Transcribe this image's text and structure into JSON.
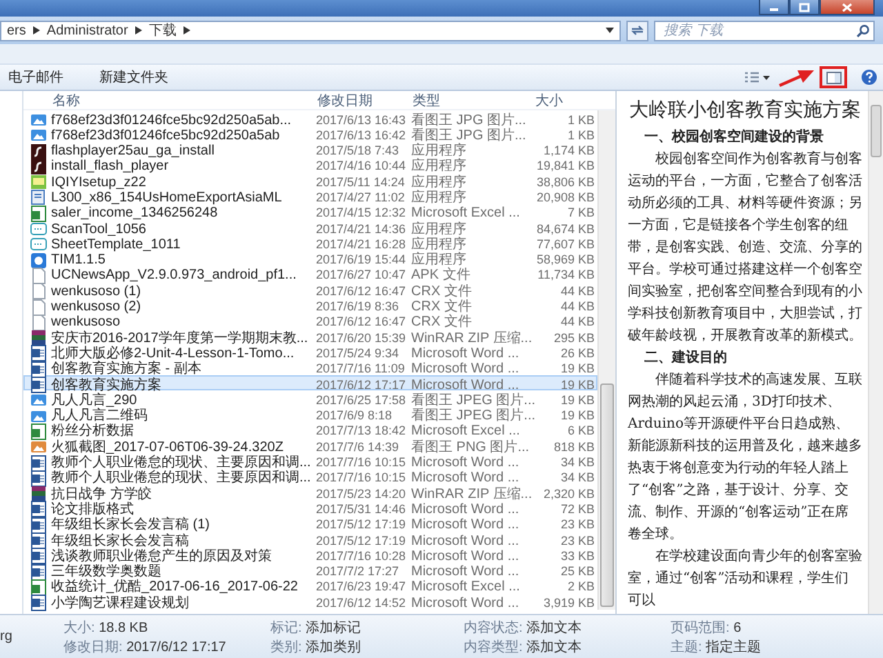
{
  "address_bar": {
    "path": [
      "ers",
      "Administrator",
      "下载"
    ],
    "search": {
      "placeholder": "搜索 下载"
    }
  },
  "toolbar": {
    "buttons": [
      "电子邮件",
      "新建文件夹"
    ],
    "preview_pane_button": {
      "highlighted": true
    }
  },
  "file_list": {
    "columns": [
      "名称",
      "修改日期",
      "类型",
      "大小"
    ],
    "rows": [
      {
        "kind": "image",
        "name": "f768ef23d3f01246fce5bc92d250a5ab...",
        "date": "2017/6/13 16:43",
        "type": "看图王 JPG 图片...",
        "size": "1 KB",
        "selected": false
      },
      {
        "kind": "image",
        "name": "f768ef23d3f01246fce5bc92d250a5ab",
        "date": "2017/6/13 16:42",
        "type": "看图王 JPG 图片...",
        "size": "1 KB",
        "selected": false
      },
      {
        "kind": "flash",
        "name": "flashplayer25au_ga_install",
        "date": "2017/5/18 7:43",
        "type": "应用程序",
        "size": "1,174 KB",
        "selected": false
      },
      {
        "kind": "flash",
        "name": "install_flash_player",
        "date": "2017/4/16 10:44",
        "type": "应用程序",
        "size": "19,841 KB",
        "selected": false
      },
      {
        "kind": "tv",
        "name": "IQIYIsetup_z22",
        "date": "2017/5/11 14:24",
        "type": "应用程序",
        "size": "38,806 KB",
        "selected": false
      },
      {
        "kind": "setup",
        "name": "L300_x86_154UsHomeExportAsiaML",
        "date": "2017/4/27 11:02",
        "type": "应用程序",
        "size": "20,908 KB",
        "selected": false
      },
      {
        "kind": "sheet",
        "name": "saler_income_1346256248",
        "date": "2017/4/15 12:32",
        "type": "Microsoft Excel ...",
        "size": "7 KB",
        "selected": false
      },
      {
        "kind": "app",
        "name": "ScanTool_1056",
        "date": "2017/4/21 14:36",
        "type": "应用程序",
        "size": "84,674 KB",
        "selected": false
      },
      {
        "kind": "app",
        "name": "SheetTemplate_1011",
        "date": "2017/4/21 16:28",
        "type": "应用程序",
        "size": "77,607 KB",
        "selected": false
      },
      {
        "kind": "chat",
        "name": "TIM1.1.5",
        "date": "2017/6/19 15:44",
        "type": "应用程序",
        "size": "58,969 KB",
        "selected": false
      },
      {
        "kind": "file",
        "name": "UCNewsApp_V2.9.0.973_android_pf1...",
        "date": "2017/6/27 10:47",
        "type": "APK 文件",
        "size": "11,734 KB",
        "selected": false
      },
      {
        "kind": "file",
        "name": "wenkusoso (1)",
        "date": "2017/6/12 16:47",
        "type": "CRX 文件",
        "size": "44 KB",
        "selected": false
      },
      {
        "kind": "file",
        "name": "wenkusoso (2)",
        "date": "2017/6/19 8:36",
        "type": "CRX 文件",
        "size": "44 KB",
        "selected": false
      },
      {
        "kind": "file",
        "name": "wenkusoso",
        "date": "2017/6/12 16:47",
        "type": "CRX 文件",
        "size": "44 KB",
        "selected": false
      },
      {
        "kind": "archive",
        "name": "安庆市2016-2017学年度第一学期期末教...",
        "date": "2017/6/20 15:39",
        "type": "WinRAR ZIP 压缩...",
        "size": "295 KB",
        "selected": false
      },
      {
        "kind": "doc",
        "name": "北师大版必修2-Unit-4-Lesson-1-Tomo...",
        "date": "2017/5/24 9:34",
        "type": "Microsoft Word ...",
        "size": "26 KB",
        "selected": false
      },
      {
        "kind": "doc",
        "name": "创客教育实施方案 - 副本",
        "date": "2017/7/16 11:09",
        "type": "Microsoft Word ...",
        "size": "19 KB",
        "selected": false
      },
      {
        "kind": "doc",
        "name": "创客教育实施方案",
        "date": "2017/6/12 17:17",
        "type": "Microsoft Word ...",
        "size": "19 KB",
        "selected": true
      },
      {
        "kind": "image",
        "name": "凡人凡言_290",
        "date": "2017/6/25 17:58",
        "type": "看图王 JPEG 图片...",
        "size": "19 KB",
        "selected": false
      },
      {
        "kind": "image",
        "name": "凡人凡言二维码",
        "date": "2017/6/9 8:18",
        "type": "看图王 JPEG 图片...",
        "size": "19 KB",
        "selected": false
      },
      {
        "kind": "sheet",
        "name": "粉丝分析数据",
        "date": "2017/7/13 18:42",
        "type": "Microsoft Excel ...",
        "size": "6 KB",
        "selected": false
      },
      {
        "kind": "png",
        "name": "火狐截图_2017-07-06T06-39-24.320Z",
        "date": "2017/7/6 14:39",
        "type": "看图王 PNG 图片...",
        "size": "818 KB",
        "selected": false
      },
      {
        "kind": "doc",
        "name": "教师个人职业倦怠的现状、主要原因和调...",
        "date": "2017/7/16 10:15",
        "type": "Microsoft Word ...",
        "size": "34 KB",
        "selected": false
      },
      {
        "kind": "doc",
        "name": "教师个人职业倦怠的现状、主要原因和调...",
        "date": "2017/7/16 10:15",
        "type": "Microsoft Word ...",
        "size": "34 KB",
        "selected": false
      },
      {
        "kind": "archive",
        "name": "抗日战争 方学皎",
        "date": "2017/5/23 14:20",
        "type": "WinRAR ZIP 压缩...",
        "size": "2,320 KB",
        "selected": false
      },
      {
        "kind": "doc",
        "name": "论文排版格式",
        "date": "2017/5/31 14:46",
        "type": "Microsoft Word ...",
        "size": "72 KB",
        "selected": false
      },
      {
        "kind": "doc",
        "name": "年级组长家长会发言稿 (1)",
        "date": "2017/5/12 17:19",
        "type": "Microsoft Word ...",
        "size": "23 KB",
        "selected": false
      },
      {
        "kind": "doc",
        "name": "年级组长家长会发言稿",
        "date": "2017/5/12 17:19",
        "type": "Microsoft Word ...",
        "size": "23 KB",
        "selected": false
      },
      {
        "kind": "doc",
        "name": "浅谈教师职业倦怠产生的原因及对策",
        "date": "2017/7/16 10:28",
        "type": "Microsoft Word ...",
        "size": "33 KB",
        "selected": false
      },
      {
        "kind": "doc",
        "name": "三年级数学奥数题",
        "date": "2017/7/2 17:27",
        "type": "Microsoft Word ...",
        "size": "25 KB",
        "selected": false
      },
      {
        "kind": "sheet",
        "name": "收益统计_优酷_2017-06-16_2017-06-22",
        "date": "2017/6/23 19:47",
        "type": "Microsoft Excel ...",
        "size": "2 KB",
        "selected": false
      },
      {
        "kind": "doc",
        "name": "小学陶艺课程建设规划",
        "date": "2017/6/12 14:52",
        "type": "Microsoft Word ...",
        "size": "3,919 KB",
        "selected": false
      }
    ]
  },
  "preview": {
    "title": "大岭联小创客教育实施方案",
    "blocks": [
      {
        "kind": "heading",
        "text": "一、校园创客空间建设的背景"
      },
      {
        "kind": "paragraph",
        "text": "校园创客空间作为创客教育与创客运动的平台，一方面，它整合了创客活动所必须的工具、材料等硬件资源；另一方面，它是链接各个学生创客的纽带，是创客实践、创造、交流、分享的平台。学校可通过搭建这样一个创客空间实验室，把创客空间整合到现有的小学科技创新教育项目中，大胆尝试，打破年龄歧视，开展教育改革的新模式。"
      },
      {
        "kind": "heading",
        "text": "二、建设目的"
      },
      {
        "kind": "paragraph",
        "text": "伴随着科学技术的高速发展、互联网热潮的风起云涌，3D打印技术、Arduino等开源硬件平台日趋成熟、新能源新科技的运用普及化，越来越多热衷于将创意变为行动的年轻人踏上了“创客”之路，基于设计、分享、交流、制作、开源的“创客运动”正在席卷全球。"
      },
      {
        "kind": "paragraph",
        "text": "在学校建设面向青少年的创客室验室，通过“创客”活动和课程，学生们可以"
      }
    ]
  },
  "status_bar": {
    "file_name": "rg",
    "details": [
      {
        "label": "大小:",
        "value": "18.8 KB"
      },
      {
        "label": "修改日期:",
        "value": "2017/6/12 17:17"
      },
      {
        "label": "标记:",
        "value": "添加标记"
      },
      {
        "label": "类别:",
        "value": "添加类别"
      },
      {
        "label": "内容状态:",
        "value": "添加文本"
      },
      {
        "label": "内容类型:",
        "value": "添加文本"
      },
      {
        "label": "页码范围:",
        "value": "6"
      },
      {
        "label": "主题:",
        "value": "指定主题"
      }
    ]
  }
}
